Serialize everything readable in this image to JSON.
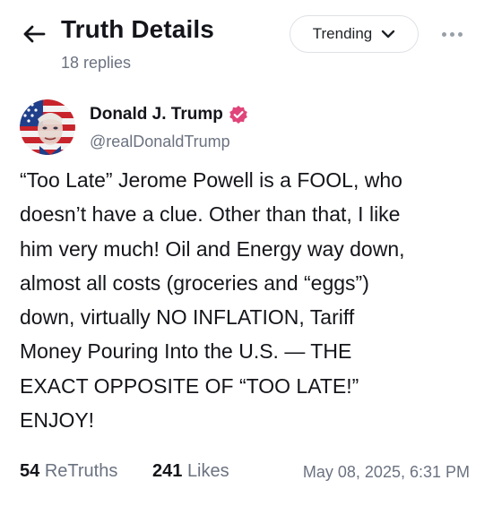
{
  "header": {
    "title": "Truth Details",
    "reply_count": "18 replies",
    "back_icon": "arrow-left-icon",
    "sort": {
      "selected": "Trending",
      "icon": "chevron-down-icon"
    },
    "more_icon": "more-horizontal-icon"
  },
  "post": {
    "author": {
      "name": "Donald J. Trump",
      "handle": "@realDonaldTrump",
      "verified_icon": "verified-badge-icon",
      "verified_color": "#e0447a"
    },
    "body": "“Too Late” Jerome Powell is a FOOL, who\ndoesn’t have a clue. Other than that, I like\nhim very much! Oil and Energy way down,\nalmost all costs (groceries and “eggs”)\ndown, virtually NO INFLATION, Tariff\nMoney Pouring Into the U.S. — THE\nEXACT OPPOSITE OF “TOO LATE!”\nENJOY!",
    "stats": {
      "retruths_count": "54",
      "retruths_label": "ReTruths",
      "likes_count": "241",
      "likes_label": "Likes"
    },
    "timestamp": "May 08, 2025, 6:31 PM"
  }
}
